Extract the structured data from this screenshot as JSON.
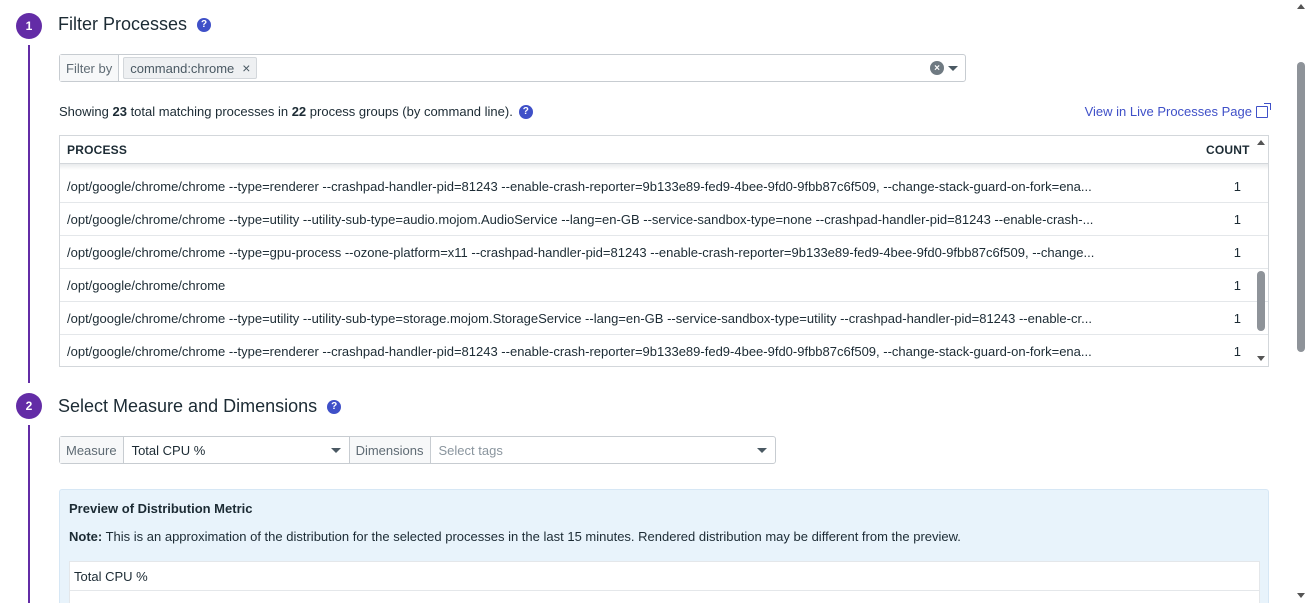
{
  "colors": {
    "accent": "#632ca6",
    "link": "#3f50c8",
    "preview_bg": "#e8f3fb"
  },
  "step1": {
    "number": "1",
    "title": "Filter Processes",
    "help": "?",
    "filter": {
      "label": "Filter by",
      "tag": "command:chrome",
      "tag_remove": "×",
      "clear": "×"
    },
    "summary": {
      "prefix": "Showing ",
      "total": "23",
      "mid": " total matching processes in ",
      "groups": "22",
      "suffix": " process groups (by command line).",
      "help": "?"
    },
    "live_link": "View in Live Processes Page",
    "table": {
      "columns": [
        "PROCESS",
        "COUNT"
      ],
      "rows": [
        {
          "process": "/opt/google/chrome/chrome --type=renderer --crashpad-handler-pid=81243 --enable-crash-reporter=9b133e89-fed9-4bee-9fd0-9fbb87c6f509, --change-stack-guard-on-fork=ena...",
          "count": "1"
        },
        {
          "process": "/opt/google/chrome/chrome --type=utility --utility-sub-type=audio.mojom.AudioService --lang=en-GB --service-sandbox-type=none --crashpad-handler-pid=81243 --enable-crash-...",
          "count": "1"
        },
        {
          "process": "/opt/google/chrome/chrome --type=gpu-process --ozone-platform=x11 --crashpad-handler-pid=81243 --enable-crash-reporter=9b133e89-fed9-4bee-9fd0-9fbb87c6f509, --change...",
          "count": "1"
        },
        {
          "process": "/opt/google/chrome/chrome",
          "count": "1"
        },
        {
          "process": "/opt/google/chrome/chrome --type=utility --utility-sub-type=storage.mojom.StorageService --lang=en-GB --service-sandbox-type=utility --crashpad-handler-pid=81243 --enable-cr...",
          "count": "1"
        },
        {
          "process": "/opt/google/chrome/chrome --type=renderer --crashpad-handler-pid=81243 --enable-crash-reporter=9b133e89-fed9-4bee-9fd0-9fbb87c6f509, --change-stack-guard-on-fork=ena...",
          "count": "1"
        }
      ]
    }
  },
  "step2": {
    "number": "2",
    "title": "Select Measure and Dimensions",
    "help": "?",
    "measure_label": "Measure",
    "measure_value": "Total CPU %",
    "dimensions_label": "Dimensions",
    "dimensions_placeholder": "Select tags"
  },
  "preview": {
    "title": "Preview of Distribution Metric",
    "note_label": "Note:",
    "note_text": " This is an approximation of the distribution for the selected processes in the last 15 minutes. Rendered distribution may be different from the preview.",
    "box_label": "Total CPU %"
  }
}
